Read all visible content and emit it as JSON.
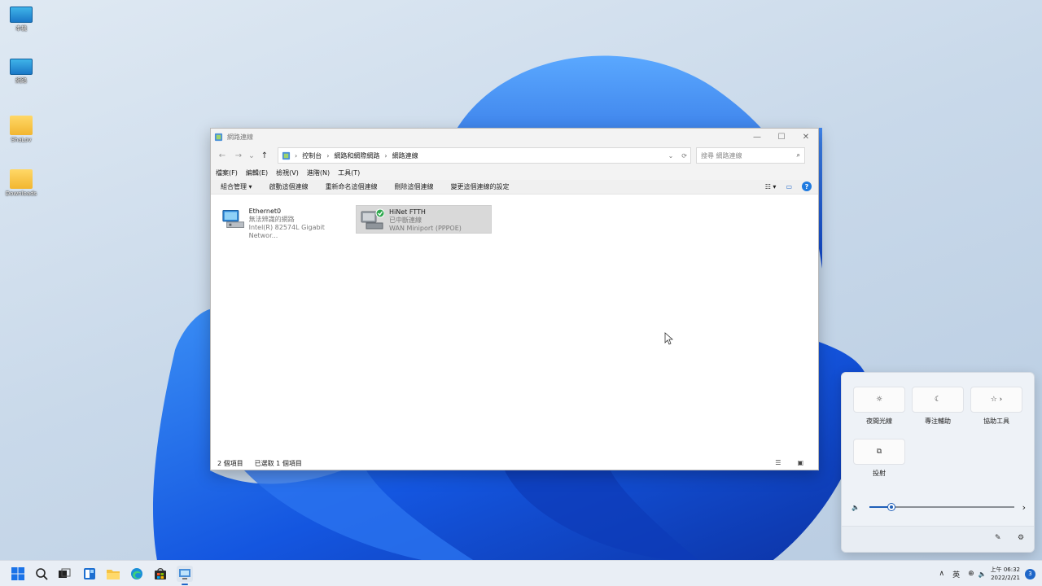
{
  "desktop": {
    "icons": [
      {
        "label": "本機",
        "type": "computer"
      },
      {
        "label": "網路",
        "type": "network"
      },
      {
        "label": "ShaLov",
        "type": "folder"
      },
      {
        "label": "Downloads",
        "type": "folder"
      }
    ]
  },
  "window": {
    "title": "網路連線",
    "controls": {
      "minimize": "—",
      "maximize": "☐",
      "close": "✕"
    },
    "nav": {
      "back": "←",
      "forward": "→",
      "recent": "⌄",
      "up": "↑"
    },
    "address": {
      "crumbs": [
        "控制台",
        "網路和網際網路",
        "網路連線"
      ],
      "separator": "›",
      "dropdown": "⌄",
      "refresh": "⟳"
    },
    "search": {
      "placeholder": "搜尋 網路連線",
      "icon": "⌕"
    },
    "menu": [
      "檔案(F)",
      "編輯(E)",
      "檢視(V)",
      "進階(N)",
      "工具(T)"
    ],
    "commands": [
      "組合管理 ▾",
      "啟動這個連線",
      "重新命名這個連線",
      "刪除這個連線",
      "變更這個連線的設定"
    ],
    "cmd_right": {
      "view": "☷ ▾",
      "pane": "▭",
      "help": "?"
    },
    "connections": [
      {
        "name": "Ethernet0",
        "status": "無法辨識的網路",
        "adapter": "Intel(R) 82574L Gigabit Networ...",
        "selected": false,
        "icon": "ethernet-adapter-icon"
      },
      {
        "name": "HiNet FTTH",
        "status": "已中斷連線",
        "adapter": "WAN Miniport (PPPOE)",
        "selected": true,
        "icon": "dialup-connection-icon"
      }
    ],
    "status": {
      "count": "2 個項目",
      "selected": "已選取 1 個項目"
    }
  },
  "quick_settings": {
    "tiles": [
      {
        "label": "夜間光線",
        "icon": "☼"
      },
      {
        "label": "專注輔助",
        "icon": "☾"
      },
      {
        "label": "協助工具",
        "icon": "☆ ›"
      },
      {
        "label": "投射",
        "icon": "⧉"
      }
    ],
    "volume": {
      "level": 0.15,
      "icon": "🔈",
      "arrow": "›"
    },
    "footer": {
      "edit": "✎",
      "settings": "⚙"
    }
  },
  "taskbar": {
    "tray": {
      "chevron": "∧",
      "ime": "英",
      "network": "⊕",
      "volume": "🔈"
    },
    "clock": {
      "time": "上午 06:32",
      "date": "2022/2/21"
    },
    "notifications": "3"
  },
  "colors": {
    "accent": "#1e66c8",
    "selection": "#d9d9d9"
  }
}
